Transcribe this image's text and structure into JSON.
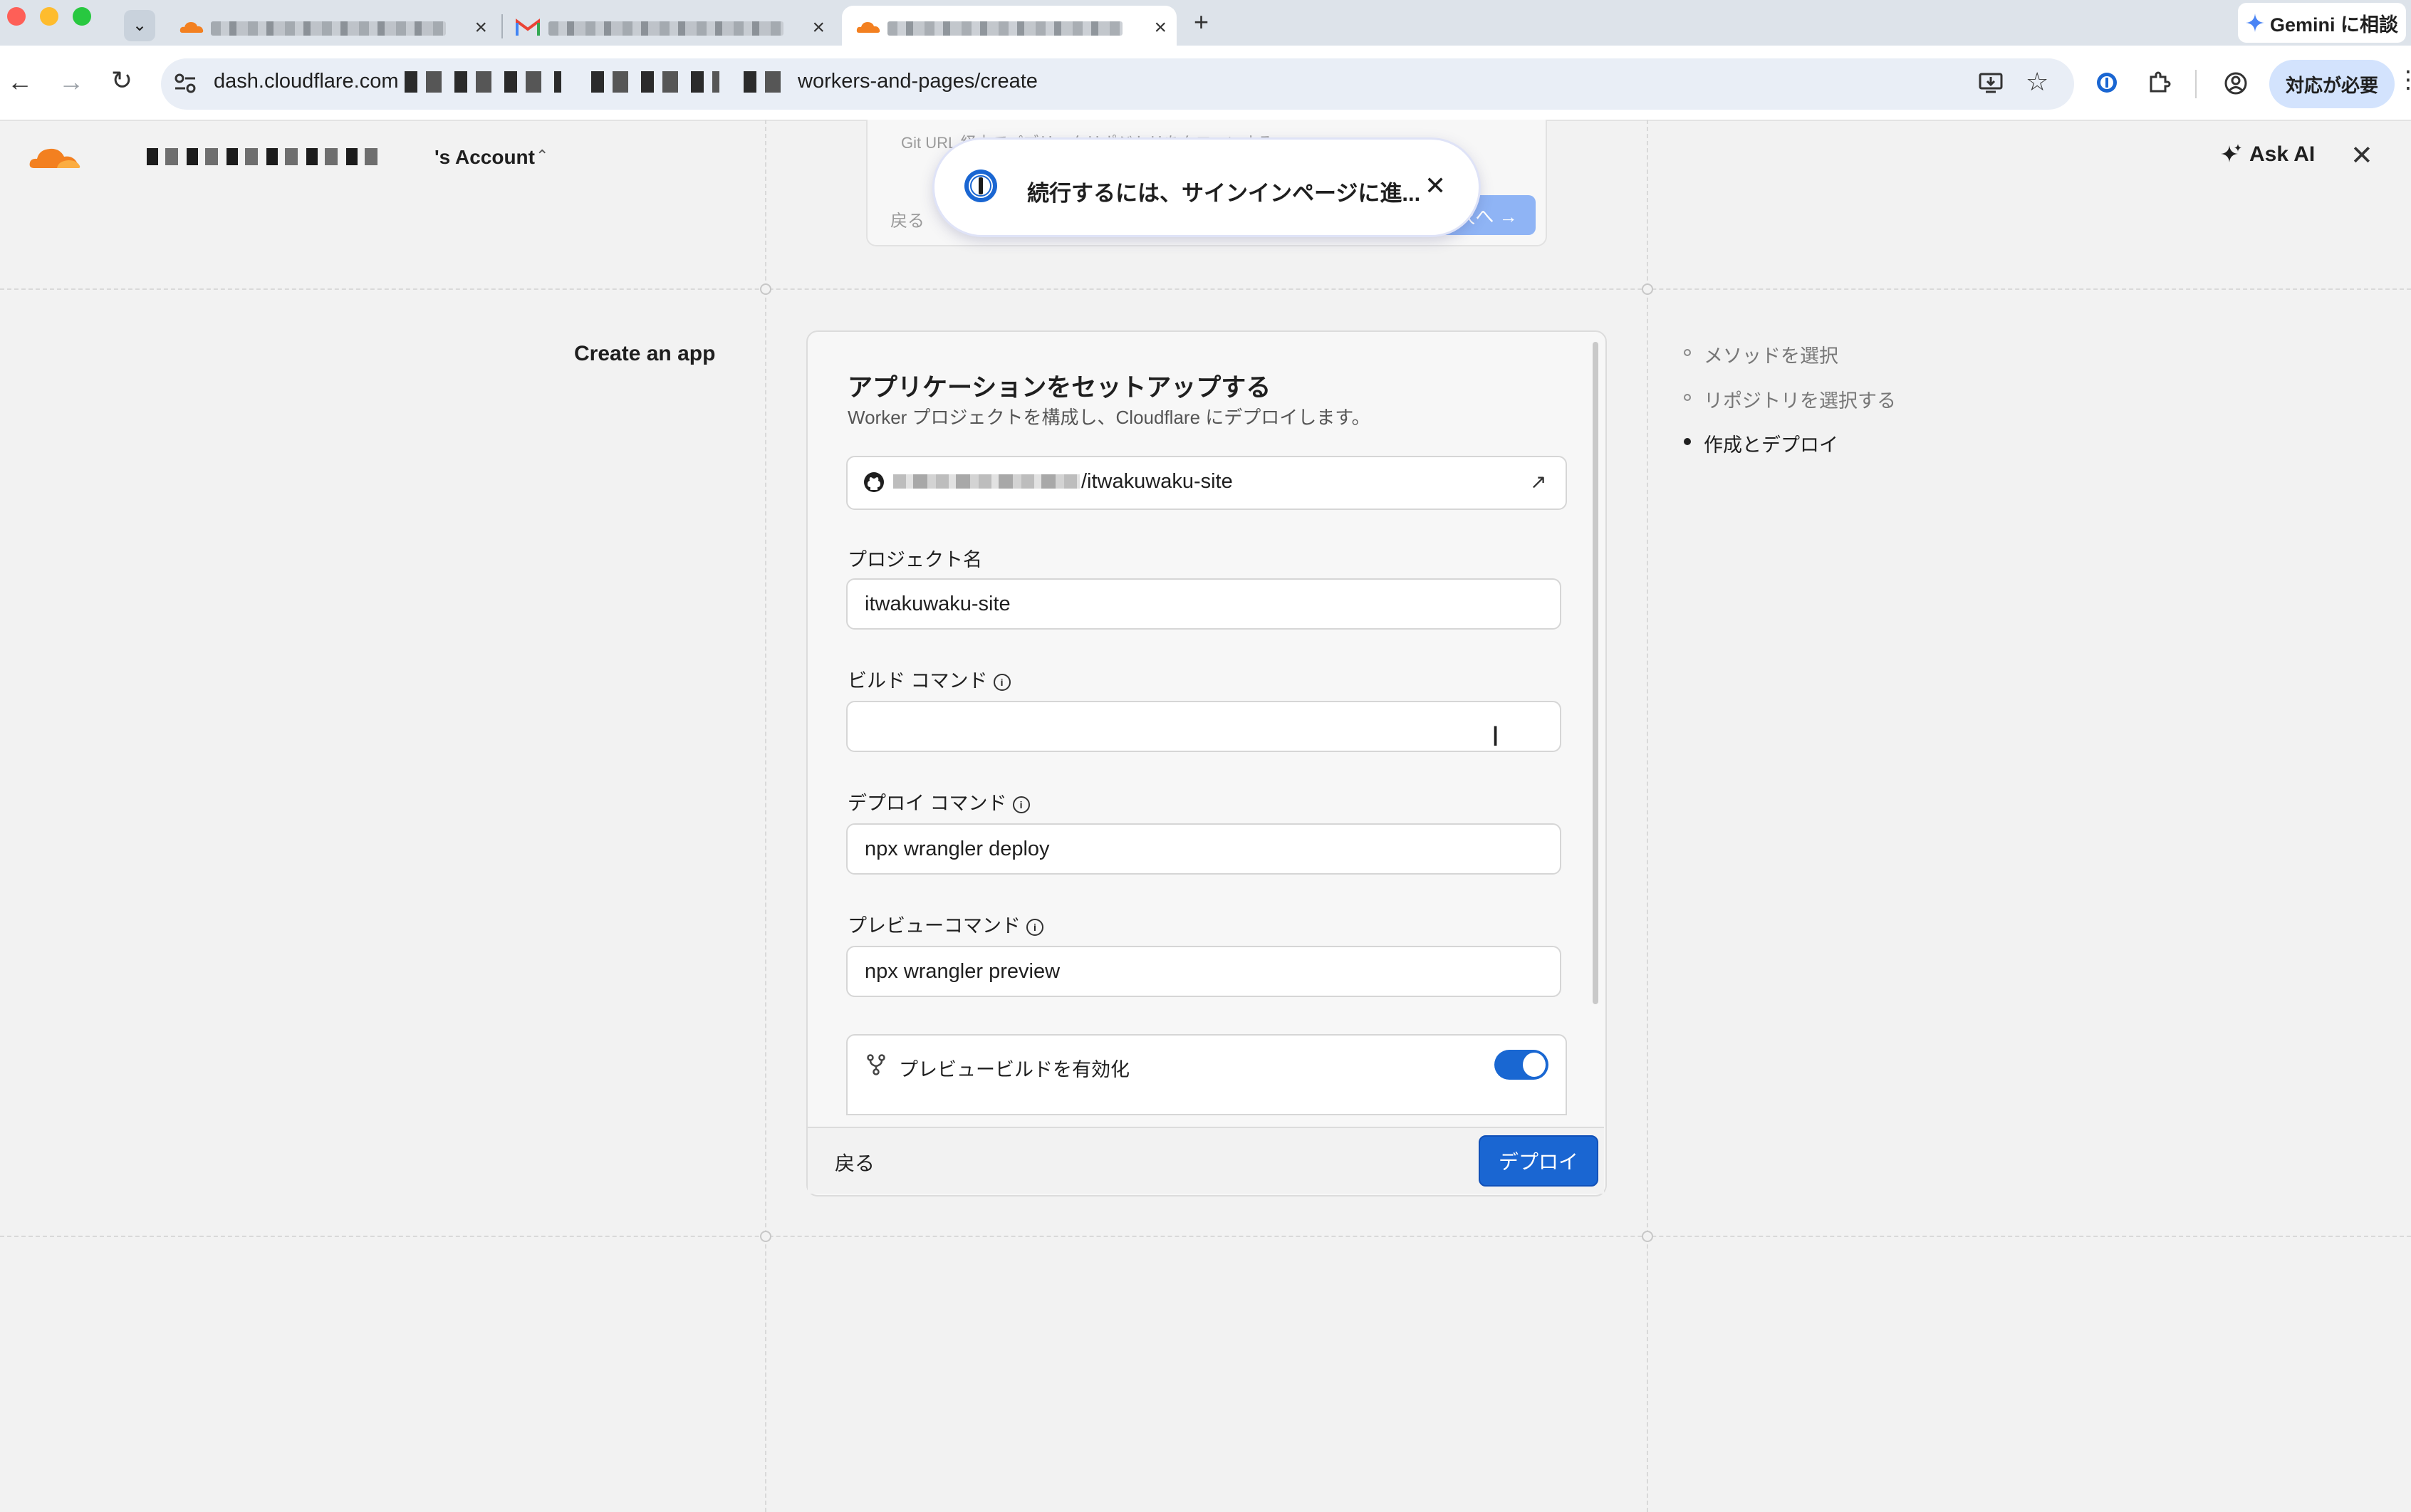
{
  "browser": {
    "tabs": [
      {
        "title": "",
        "icon": "cloudflare-icon",
        "active": false
      },
      {
        "title": "",
        "icon": "gmail-icon",
        "active": false
      },
      {
        "title": "",
        "icon": "cloudflare-icon",
        "active": true
      }
    ],
    "new_tab_label": "+",
    "gemini_label": "Gemini に相談",
    "url_host": "dash.cloudflare.com",
    "url_path": "workers-and-pages/create",
    "needs_action_label": "対応が必要"
  },
  "header": {
    "account_label": "'s Account",
    "ask_ai_label": "Ask AI"
  },
  "previous_step": {
    "git_url_text": "Git URL 経由でパブリックリポジトリをクローンする ›",
    "back_label": "戻る",
    "next_label": "次へ →"
  },
  "onepassword_popup": {
    "message": "続行するには、サインインページに進..."
  },
  "sidebar": {
    "create_app_label": "Create an app"
  },
  "stepper": {
    "steps": [
      {
        "label": "メソッドを選択",
        "state": "done"
      },
      {
        "label": "リポジトリを選択する",
        "state": "done"
      },
      {
        "label": "作成とデプロイ",
        "state": "current"
      }
    ]
  },
  "form": {
    "title": "アプリケーションをセットアップする",
    "subtitle": "Worker プロジェクトを構成し、Cloudflare にデプロイします。",
    "repo_name": "/itwakuwaku-site",
    "project_name_label": "プロジェクト名",
    "project_name_value": "itwakuwaku-site",
    "build_command_label": "ビルド コマンド",
    "build_command_value": "",
    "deploy_command_label": "デプロイ コマンド",
    "deploy_command_value": "npx wrangler deploy",
    "preview_command_label": "プレビューコマンド",
    "preview_command_value": "npx wrangler preview",
    "preview_builds_label": "プレビュービルドを有効化",
    "preview_builds_enabled": true,
    "back_label": "戻る",
    "deploy_label": "デプロイ"
  },
  "colors": {
    "accent": "#1a66d2",
    "cloudflare_orange": "#f38020",
    "page_bg": "#f2f2f2"
  }
}
